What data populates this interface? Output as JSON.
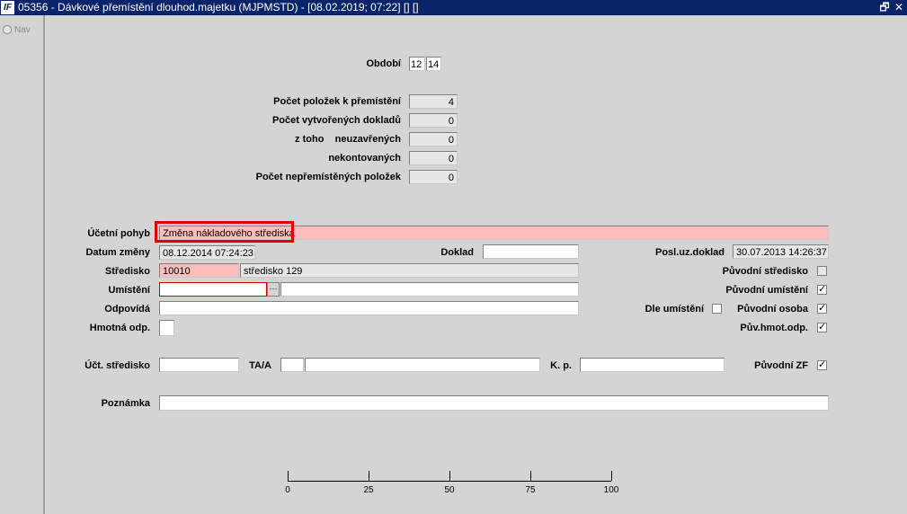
{
  "window": {
    "logo_text": "IF",
    "title": "05356 - Dávkové přemístění dlouhod.majetku (MJPMSTD) - [08.02.2019; 07:22]  [] []",
    "restore_glyph": "🗗",
    "close_glyph": "✕"
  },
  "nav": {
    "label": "Nav"
  },
  "form": {
    "obdobi": {
      "label": "Období",
      "value1": "12",
      "value2": "14"
    },
    "pocet_polozek": {
      "label": "Počet položek k přemístění",
      "value": "4"
    },
    "pocet_dokladu": {
      "label": "Počet vytvořených dokladů",
      "value": "0"
    },
    "ztoho_neuzavrenych": {
      "label": "z toho    neuzavřených",
      "value": "0"
    },
    "nekontovanych": {
      "label": "nekontovaných",
      "value": "0"
    },
    "nepremistenych": {
      "label": "Počet nepřemístěných položek",
      "value": "0"
    },
    "ucetni_pohyb": {
      "label": "Účetní pohyb",
      "value": "Změna nákladového střediska"
    },
    "datum_zmeny": {
      "label": "Datum změny",
      "value": "08.12.2014 07:24:23"
    },
    "doklad": {
      "label": "Doklad",
      "value": ""
    },
    "posl_uz_doklad": {
      "label": "Posl.uz.doklad",
      "value": "30.07.2013 14:26:37"
    },
    "stredisko": {
      "label": "Středisko",
      "code": "10010",
      "name": "středisko 129"
    },
    "puvodni_stredisko": {
      "label": "Původní středisko",
      "checked": false
    },
    "umisteni": {
      "label": "Umístění",
      "code": "",
      "ellipsis": "···",
      "name": ""
    },
    "puvodni_umisteni": {
      "label": "Původní umístění",
      "checked": true,
      "mark": "✓"
    },
    "odpovida": {
      "label": "Odpovídá",
      "value": ""
    },
    "dle_umisteni": {
      "label": "Dle umístění",
      "checked": false
    },
    "puvodni_osoba": {
      "label": "Původní osoba",
      "checked": true,
      "mark": "✓"
    },
    "hmotna_odp": {
      "label": "Hmotná odp.",
      "value": ""
    },
    "puv_hmot_odp": {
      "label": "Pův.hmot.odp.",
      "checked": true,
      "mark": "✓"
    },
    "uct_stredisko": {
      "label": "Účt. středisko",
      "value": ""
    },
    "ta_a": {
      "label": "TA/A",
      "value1": "",
      "value2": ""
    },
    "k_p": {
      "label": "K. p.",
      "value": ""
    },
    "puvodni_zf": {
      "label": "Původní ZF",
      "checked": true,
      "mark": "✓"
    },
    "poznamka": {
      "label": "Poznámka",
      "value": ""
    }
  },
  "progress_scale": {
    "ticks": [
      "0",
      "25",
      "50",
      "75",
      "100"
    ]
  }
}
